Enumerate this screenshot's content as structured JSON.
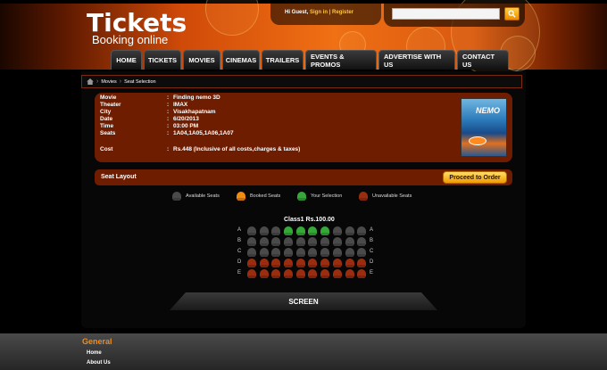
{
  "header": {
    "logo_title": "Tickets",
    "logo_subtitle": "Booking online",
    "greeting": "Hi Guest,",
    "sign_in": "Sign in",
    "separator": "|",
    "register": "Register",
    "search_placeholder": "",
    "search_icon": "search-icon"
  },
  "nav": {
    "items": [
      "HOME",
      "TICKETS",
      "MOVIES",
      "CINEMAS",
      "TRAILERS",
      "EVENTS & PROMOS",
      "ADVERTISE WITH US",
      "CONTACT US"
    ]
  },
  "breadcrumb": {
    "home_icon": "home-icon",
    "items": [
      "Movies",
      "Seat Selection"
    ]
  },
  "booking": {
    "rows": [
      {
        "label": "Movie",
        "value": "Finding nemo 3D"
      },
      {
        "label": "Theater",
        "value": "IMAX"
      },
      {
        "label": "City",
        "value": "Visakhapatnam"
      },
      {
        "label": "Date",
        "value": "6/20/2013"
      },
      {
        "label": "Time",
        "value": "03:00 PM"
      },
      {
        "label": "Seats",
        "value": "1A04,1A05,1A06,1A07"
      }
    ],
    "cost_label": "Cost",
    "cost_value": "Rs.448 (Inclusive of all costs,charges & taxes)",
    "poster_title": "NEMO"
  },
  "seat_layout": {
    "title": "Seat Layout",
    "proceed_label": "Proceed to Order",
    "legend": {
      "available": "Available Seats",
      "booked": "Booked Seats",
      "mine": "Your Selection",
      "unavailable": "Unavailable Seats"
    },
    "class_title": "Class1 Rs.100.00",
    "rows": [
      {
        "label": "A",
        "seats": [
          "avail",
          "avail",
          "avail",
          "mine",
          "mine",
          "mine",
          "mine",
          "avail",
          "avail",
          "avail"
        ]
      },
      {
        "label": "B",
        "seats": [
          "avail",
          "avail",
          "avail",
          "avail",
          "avail",
          "avail",
          "avail",
          "avail",
          "avail",
          "avail"
        ]
      },
      {
        "label": "C",
        "seats": [
          "avail",
          "avail",
          "avail",
          "avail",
          "avail",
          "avail",
          "avail",
          "avail",
          "avail",
          "avail"
        ]
      },
      {
        "label": "D",
        "seats": [
          "unavail",
          "unavail",
          "unavail",
          "unavail",
          "unavail",
          "unavail",
          "unavail",
          "unavail",
          "unavail",
          "unavail"
        ]
      },
      {
        "label": "E",
        "seats": [
          "unavail",
          "unavail",
          "unavail",
          "unavail",
          "unavail",
          "unavail",
          "unavail",
          "unavail",
          "unavail",
          "unavail"
        ]
      }
    ],
    "screen_label": "SCREEN"
  },
  "footer": {
    "title": "General",
    "links": [
      "Home",
      "About Us"
    ]
  },
  "colors": {
    "accent_orange": "#f08c1a",
    "panel_brown": "#6e1d00",
    "seat_available": "#4a4a4a",
    "seat_booked": "#f08a10",
    "seat_mine": "#36a838",
    "seat_unavailable": "#9a2c10"
  }
}
